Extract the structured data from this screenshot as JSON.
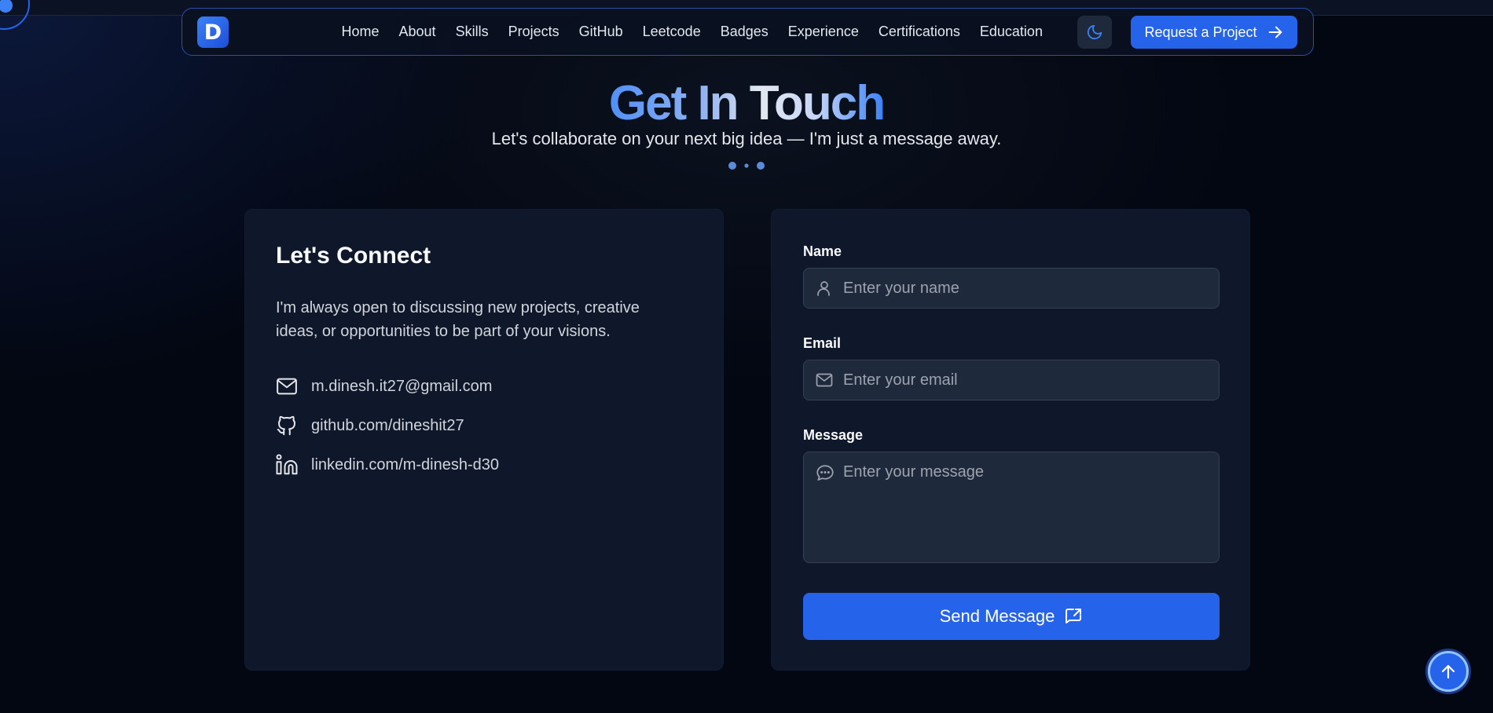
{
  "nav": {
    "logo_letter": "D",
    "links": [
      "Home",
      "About",
      "Skills",
      "Projects",
      "GitHub",
      "Leetcode",
      "Badges",
      "Experience",
      "Certifications",
      "Education"
    ],
    "theme_icon": "moon-icon",
    "cta_label": "Request a Project",
    "cta_icon": "arrow-right-icon"
  },
  "hero": {
    "title": "Get In Touch",
    "subtitle": "Let's collaborate on your next big idea — I'm just a message away."
  },
  "connect": {
    "title": "Let's Connect",
    "text": "I'm always open to discussing new projects, creative ideas, or opportunities to be part of your visions.",
    "contacts": [
      {
        "icon": "mail-icon",
        "label": "m.dinesh.it27@gmail.com"
      },
      {
        "icon": "github-icon",
        "label": "github.com/dineshit27"
      },
      {
        "icon": "linkedin-icon",
        "label": "linkedin.com/m-dinesh-d30"
      }
    ]
  },
  "form": {
    "name_label": "Name",
    "name_placeholder": "Enter your name",
    "email_label": "Email",
    "email_placeholder": "Enter your email",
    "message_label": "Message",
    "message_placeholder": "Enter your message",
    "submit_label": "Send Message",
    "submit_icon": "share-icon"
  },
  "scroll_top_icon": "arrow-up-icon",
  "colors": {
    "accent": "#2563eb",
    "background": "#030712",
    "card": "#0f172a",
    "field": "#1e293b"
  }
}
